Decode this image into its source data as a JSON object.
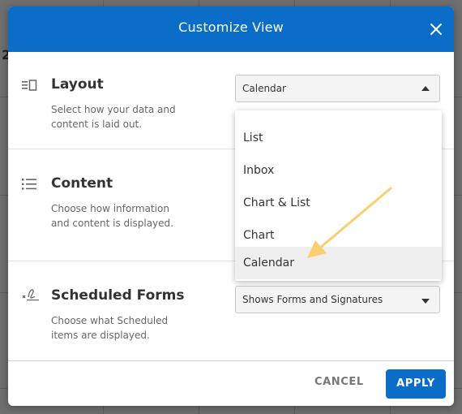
{
  "background": {
    "partial_label": "2"
  },
  "modal": {
    "title": "Customize View",
    "close_icon": "close-icon",
    "header_color": "#0b6dc8",
    "sections": {
      "layout": {
        "title": "Layout",
        "description": "Select how your data and content is laid out.",
        "icon": "layout-icon",
        "selected": "Calendar",
        "options": [
          "List",
          "Inbox",
          "Chart & List",
          "Chart",
          "Calendar"
        ]
      },
      "content": {
        "title": "Content",
        "description": "Choose how information and content is displayed.",
        "icon": "list-icon"
      },
      "scheduled_forms": {
        "title": "Scheduled Forms",
        "description": "Choose what Scheduled items are displayed.",
        "icon": "signature-icon",
        "selected": "Shows Forms and Signatures"
      }
    },
    "footer": {
      "cancel_label": "CANCEL",
      "apply_label": "APPLY"
    }
  },
  "annotation": {
    "arrow_color": "#f9cf6f",
    "icon": "arrow-annotation-icon"
  }
}
